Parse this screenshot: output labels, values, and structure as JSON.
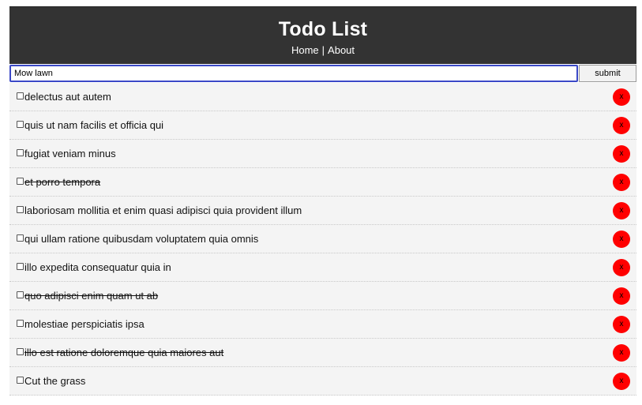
{
  "header": {
    "title": "Todo List",
    "nav": {
      "home_label": "Home",
      "separator": "|",
      "about_label": "About"
    }
  },
  "add_form": {
    "input_value": "Mow lawn",
    "submit_label": "submit"
  },
  "colors": {
    "header_bg": "#333333",
    "delete_button": "#ff0000",
    "input_focus_border": "#3b49c7",
    "row_bg": "#f4f4f4"
  },
  "todos": [
    {
      "title": "delectus aut autem",
      "completed": false,
      "delete_label": "x"
    },
    {
      "title": "quis ut nam facilis et officia qui",
      "completed": false,
      "delete_label": "x"
    },
    {
      "title": "fugiat veniam minus",
      "completed": false,
      "delete_label": "x"
    },
    {
      "title": "et porro tempora",
      "completed": true,
      "delete_label": "x"
    },
    {
      "title": "laboriosam mollitia et enim quasi adipisci quia provident illum",
      "completed": false,
      "delete_label": "x"
    },
    {
      "title": "qui ullam ratione quibusdam voluptatem quia omnis",
      "completed": false,
      "delete_label": "x"
    },
    {
      "title": "illo expedita consequatur quia in",
      "completed": false,
      "delete_label": "x"
    },
    {
      "title": "quo adipisci enim quam ut ab",
      "completed": true,
      "delete_label": "x"
    },
    {
      "title": "molestiae perspiciatis ipsa",
      "completed": false,
      "delete_label": "x"
    },
    {
      "title": "illo est ratione doloremque quia maiores aut",
      "completed": true,
      "delete_label": "x"
    },
    {
      "title": "Cut the grass",
      "completed": false,
      "delete_label": "x"
    }
  ]
}
